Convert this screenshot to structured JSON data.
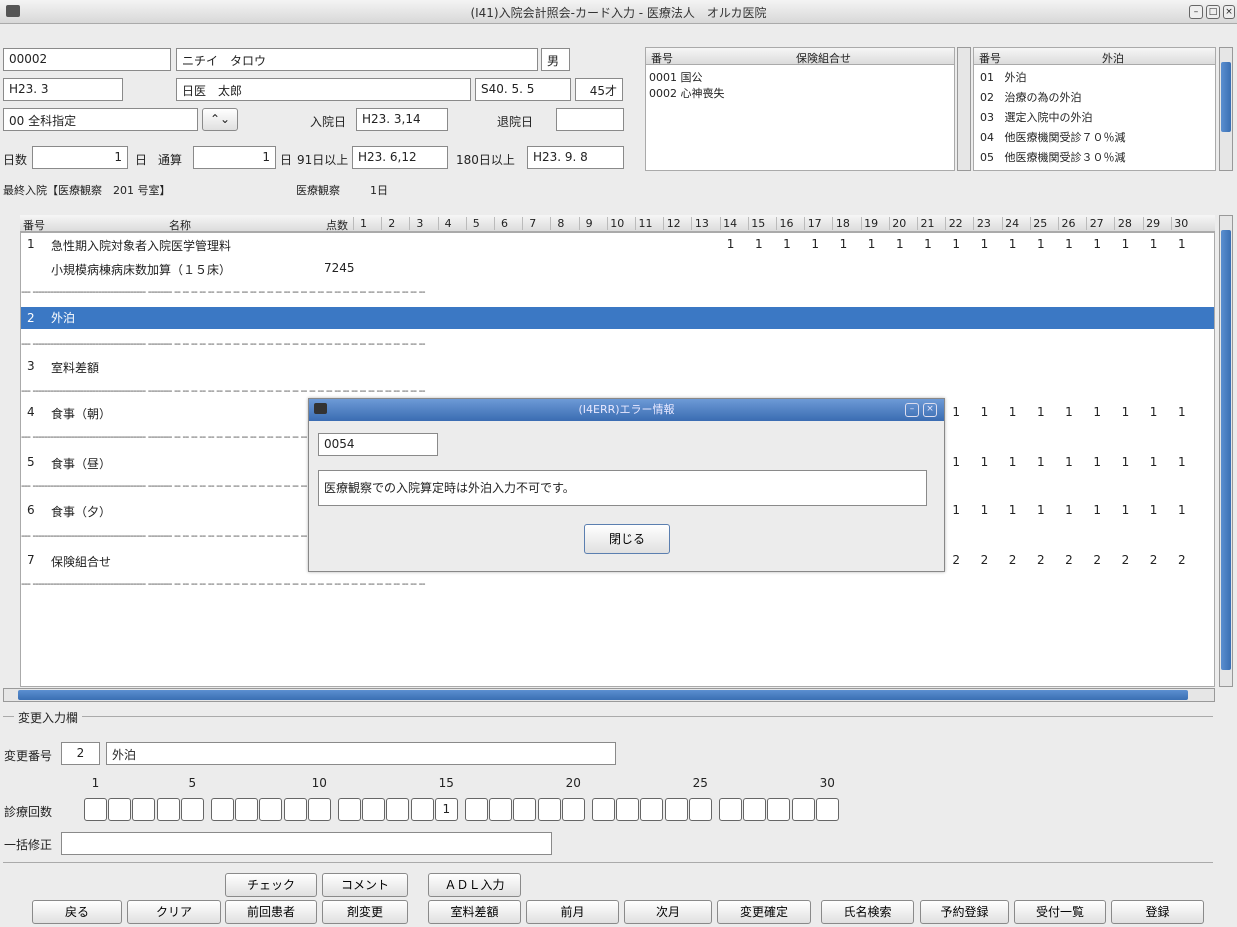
{
  "window": {
    "title": "(I41)入院会計照会-カード入力 - 医療法人　オルカ医院"
  },
  "patient": {
    "id": "00002",
    "kana": "ニチイ　タロウ",
    "sex": "男",
    "era": "H23. 3",
    "name": "日医　太郎",
    "birth": "S40. 5. 5",
    "age": "45才",
    "dept": "00 全科指定",
    "admit_label": "入院日",
    "admit_date": "H23. 3,14",
    "discharge_label": "退院日",
    "discharge_date": "",
    "days_label": "日数",
    "days_value": "1",
    "day_unit": "日",
    "total_label": "通算",
    "total_value": "1",
    "day91_label": "91日以上",
    "day91_value": "H23. 6,12",
    "day180_label": "180日以上",
    "day180_value": "H23. 9. 8",
    "last_admit": "最終入院【医療観察　201 号室】",
    "observe_label": "医療観察",
    "observe_days": "1日"
  },
  "insurance": {
    "col_num": "番号",
    "col_name": "保険組合せ",
    "rows": [
      {
        "num": "0001",
        "name": "国公"
      },
      {
        "num": "0002",
        "name": "心神喪失"
      }
    ]
  },
  "outing": {
    "col_num": "番号",
    "col_name": "外泊",
    "rows": [
      {
        "num": "01",
        "name": "外泊"
      },
      {
        "num": "02",
        "name": "治療の為の外泊"
      },
      {
        "num": "03",
        "name": "選定入院中の外泊"
      },
      {
        "num": "04",
        "name": "他医療機関受診７０％減"
      },
      {
        "num": "05",
        "name": "他医療機関受診３０％減"
      }
    ]
  },
  "grid": {
    "headers": {
      "num": "番号",
      "name": "名称",
      "points": "点数",
      "days": [
        "1",
        "2",
        "3",
        "4",
        "5",
        "6",
        "7",
        "8",
        "9",
        "10",
        "11",
        "12",
        "13",
        "14",
        "15",
        "16",
        "17",
        "18",
        "19",
        "20",
        "21",
        "22",
        "23",
        "24",
        "25",
        "26",
        "27",
        "28",
        "29",
        "30"
      ]
    },
    "rows": [
      {
        "num": "1",
        "name": "急性期入院対象者入院医学管理料",
        "sub": "小規模病棟病床数加算（１５床）",
        "points": "7245",
        "vals": "1"
      },
      {
        "num": "2",
        "name": "外泊"
      },
      {
        "num": "3",
        "name": "室料差額"
      },
      {
        "num": "4",
        "name": "食事（朝）",
        "vals": "1"
      },
      {
        "num": "5",
        "name": "食事（昼）",
        "vals": "1"
      },
      {
        "num": "6",
        "name": "食事（夕）",
        "vals": "1"
      },
      {
        "num": "7",
        "name": "保険組合せ",
        "vals": "2"
      }
    ]
  },
  "change": {
    "section": "変更入力欄",
    "num_label": "変更番号",
    "num_value": "2",
    "name_value": "外泊",
    "scale": [
      "1",
      "5",
      "10",
      "15",
      "20",
      "25",
      "30"
    ],
    "count_label": "診療回数",
    "count_15": "1",
    "bulk_label": "一括修正"
  },
  "dialog": {
    "title": "(I4ERR)エラー情報",
    "code": "0054",
    "message": "医療観察での入院算定時は外泊入力不可です。",
    "close": "閉じる"
  },
  "buttons": {
    "check": "チェック",
    "comment": "コメント",
    "adl": "ＡＤＬ入力",
    "back": "戻る",
    "clear": "クリア",
    "prev_patient": "前回患者",
    "change_dose": "剤変更",
    "room": "室料差額",
    "prev_month": "前月",
    "next_month": "次月",
    "confirm": "変更確定",
    "name_search": "氏名検索",
    "reserve": "予約登録",
    "reception": "受付一覧",
    "register": "登録"
  }
}
